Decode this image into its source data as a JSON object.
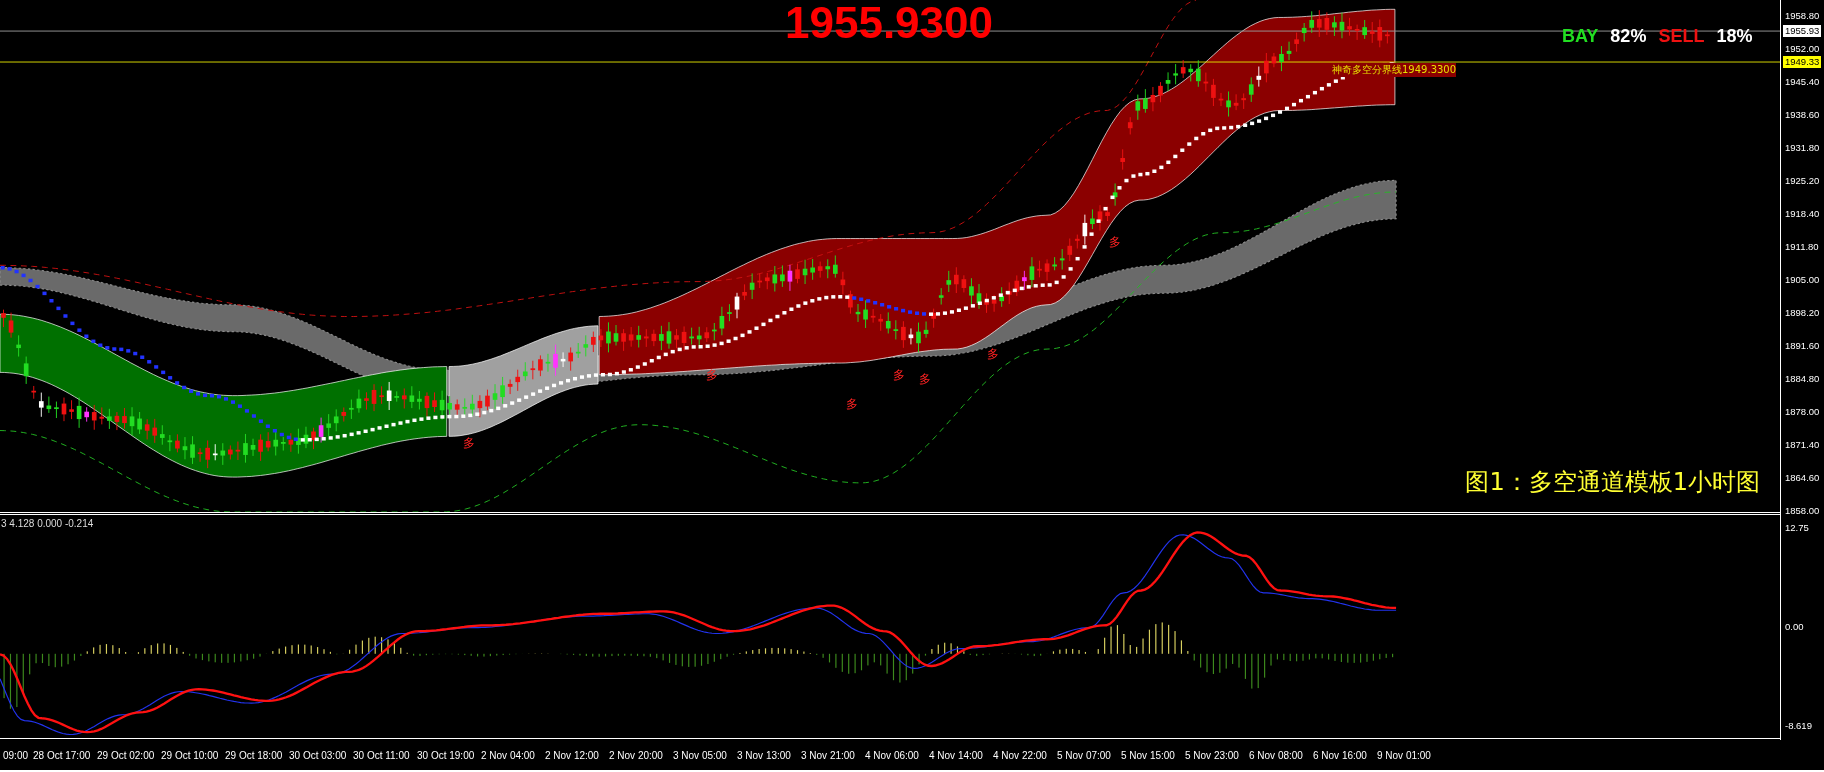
{
  "quote": {
    "price": "1955.9300"
  },
  "sentiment": {
    "buy_label": "BAY",
    "buy_value": "82%",
    "sell_label": "SELL",
    "sell_value": "18%"
  },
  "divider_label": "神奇多空分界线1949.3300",
  "signal_markers": [
    "多",
    "多",
    "多",
    "多",
    "多",
    "多",
    "多"
  ],
  "caption": "图1：多空通道模板1小时图",
  "price_axis": {
    "ticks": [
      "1958.80",
      "1952.00",
      "1945.40",
      "1938.60",
      "1931.80",
      "1925.20",
      "1918.40",
      "1911.80",
      "1905.00",
      "1898.20",
      "1891.60",
      "1884.80",
      "1878.00",
      "1871.40",
      "1864.60",
      "1858.00"
    ],
    "bid": "1955.93",
    "divider": "1949.33"
  },
  "indicator": {
    "values": "3 4.128 0.000 -0.214",
    "ticks": [
      "12.75",
      "0.00",
      "-8.619"
    ]
  },
  "time_axis": [
    "09:00",
    "28 Oct 17:00",
    "29 Oct 02:00",
    "29 Oct 10:00",
    "29 Oct 18:00",
    "30 Oct 03:00",
    "30 Oct 11:00",
    "30 Oct 19:00",
    "2 Nov 04:00",
    "2 Nov 12:00",
    "2 Nov 20:00",
    "3 Nov 05:00",
    "3 Nov 13:00",
    "3 Nov 21:00",
    "4 Nov 06:00",
    "4 Nov 14:00",
    "4 Nov 22:00",
    "5 Nov 07:00",
    "5 Nov 15:00",
    "5 Nov 23:00",
    "6 Nov 08:00",
    "6 Nov 16:00",
    "9 Nov 01:00"
  ]
}
